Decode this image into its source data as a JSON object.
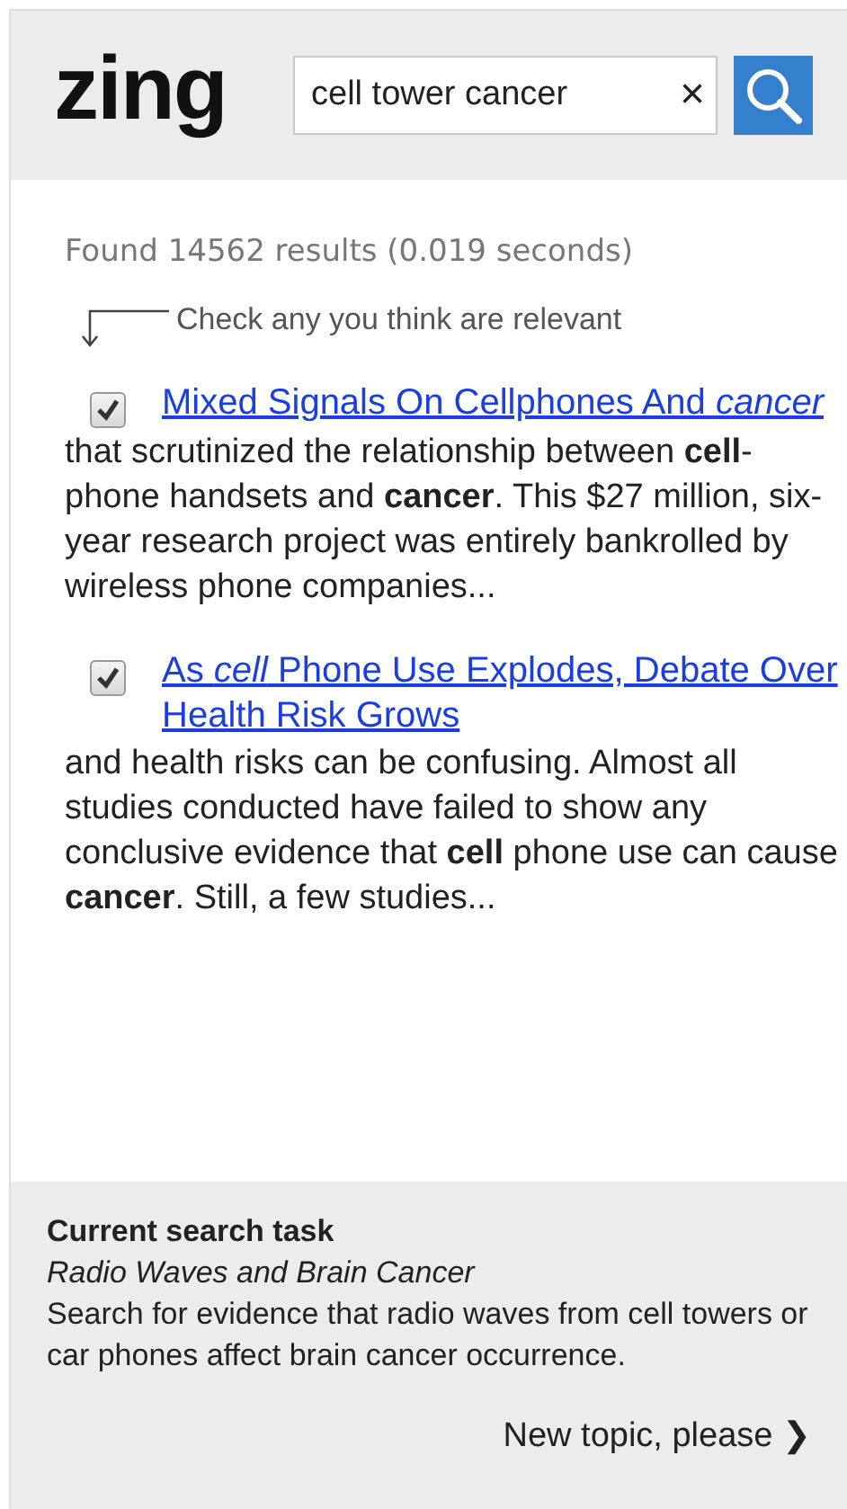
{
  "header": {
    "logo": "zing",
    "search": {
      "value": "cell tower cancer",
      "clear": "×"
    }
  },
  "results_summary": "Found 14562 results (0.019 seconds)",
  "hint": "Check any you think are relevant",
  "results": [
    {
      "title": "Mixed Signals On Cellphones And *cancer*",
      "checked": true,
      "snippet": "that scrutinized the relationship between **cell**-phone handsets and **cancer**. This $27 million, six-year research project was entirely bankrolled by wireless phone companies..."
    },
    {
      "title": "As *cell* Phone Use Explodes, Debate Over Health Risk Grows",
      "checked": true,
      "snippet": "and health risks can be confusing. Almost all studies conducted have failed to show any conclusive evidence that **cell** phone use can cause **cancer**. Still, a few studies..."
    }
  ],
  "task": {
    "heading": "Current search task",
    "topic": "Radio Waves and Brain Cancer",
    "description": "Search for evidence that radio waves from cell towers or car phones affect brain cancer occurrence.",
    "next": "New topic, please ❯"
  }
}
